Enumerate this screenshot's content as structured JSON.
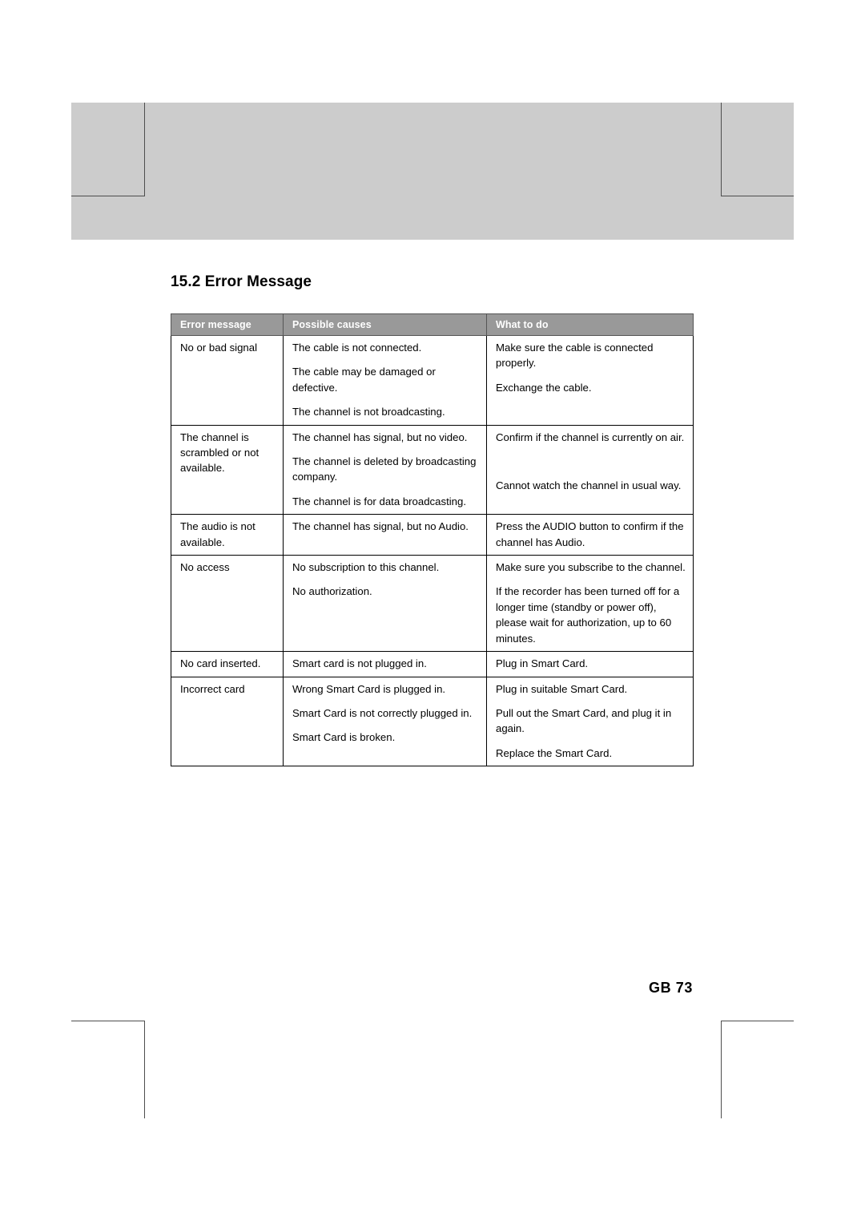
{
  "page": {
    "section_number_title": "15.2 Error Message",
    "footer": "GB 73"
  },
  "table": {
    "headers": {
      "error_message": "Error message",
      "possible_causes": "Possible causes",
      "what_to_do": "What to do"
    },
    "rows": [
      {
        "error_message": "No or bad signal",
        "items": [
          {
            "cause": "The cable is not connected.",
            "action": "Make sure the cable is connected properly."
          },
          {
            "cause": "The cable may be damaged or defective.",
            "action": "Exchange the cable."
          },
          {
            "cause": "The channel is not broadcasting.",
            "action": ""
          }
        ]
      },
      {
        "error_message": "The channel is scrambled or not available.",
        "items": [
          {
            "cause": "The channel has signal, but no video.",
            "action": "Confirm if the channel is currently on air."
          },
          {
            "cause": "The channel is deleted by broadcasting company.",
            "action": ""
          },
          {
            "cause": "The channel is for data broadcasting.",
            "action": "Cannot watch the channel in usual way."
          }
        ]
      },
      {
        "error_message": "The audio is not available.",
        "items": [
          {
            "cause": "The channel has signal, but no Audio.",
            "action": "Press the AUDIO button to confirm if the channel has Audio."
          }
        ]
      },
      {
        "error_message": "No access",
        "items": [
          {
            "cause": "No subscription to this channel.",
            "action": "Make sure you subscribe to the channel."
          },
          {
            "cause": "No authorization.",
            "action": "If the recorder has been turned off for a longer time (standby or power off), please wait for authorization, up to 60 minutes."
          }
        ]
      },
      {
        "error_message": "No card inserted.",
        "items": [
          {
            "cause": "Smart card is not plugged in.",
            "action": "Plug in Smart Card."
          }
        ]
      },
      {
        "error_message": "Incorrect card",
        "items": [
          {
            "cause": "Wrong Smart Card is plugged in.",
            "action": "Plug in suitable Smart Card."
          },
          {
            "cause": "Smart Card is not correctly plugged in.",
            "action": "Pull out the Smart Card, and plug it in again."
          },
          {
            "cause": "Smart Card is broken.",
            "action": "Replace the Smart Card."
          }
        ]
      }
    ]
  }
}
